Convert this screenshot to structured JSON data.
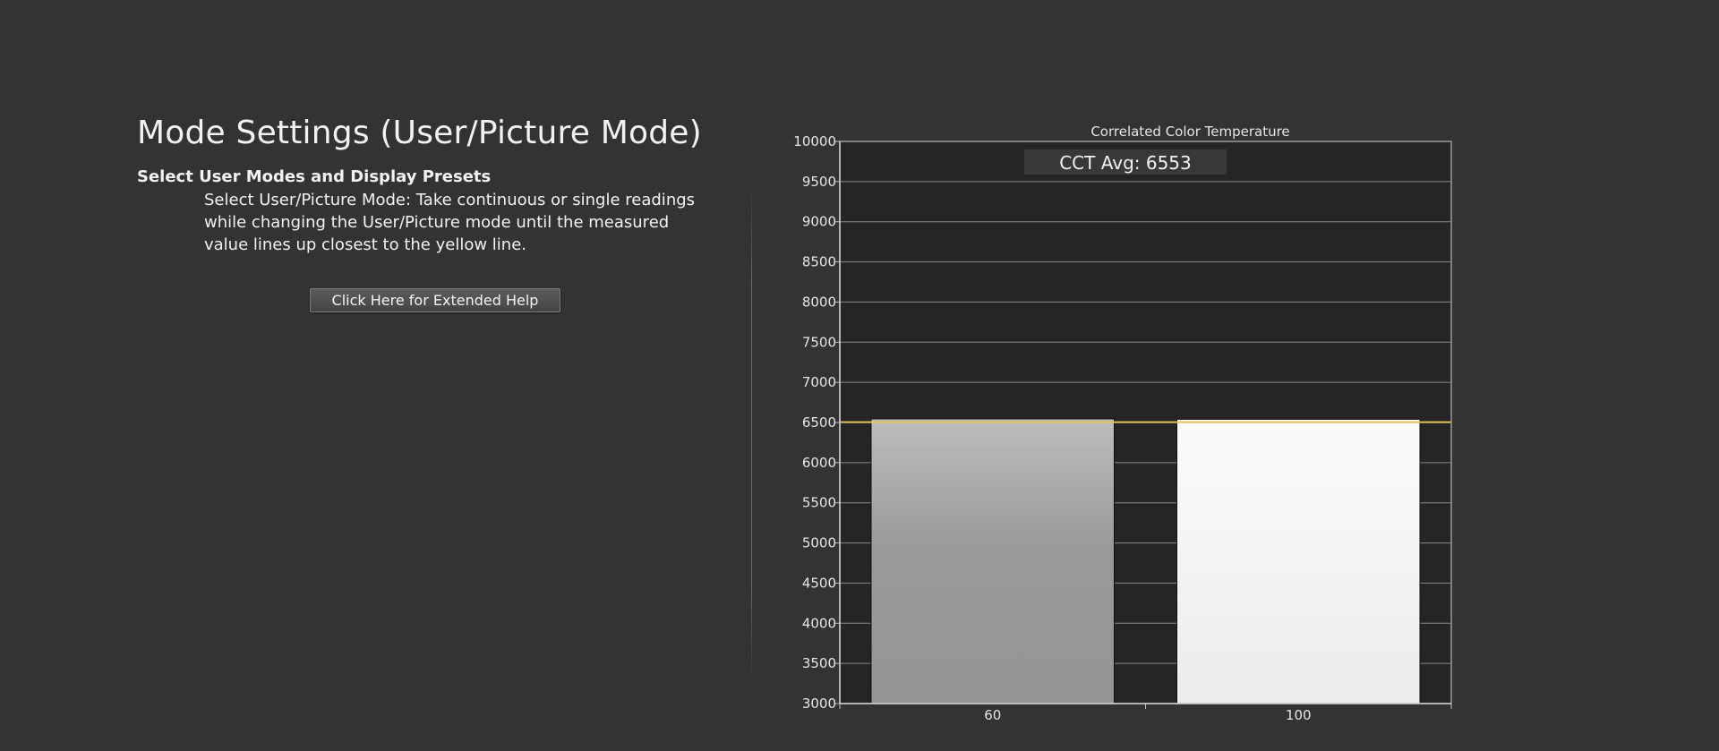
{
  "page": {
    "title": "Mode Settings (User/Picture Mode)",
    "section_heading": "Select User Modes and Display Presets",
    "instructions": "Select User/Picture Mode: Take continuous or single readings while changing the User/Picture mode until the measured value lines up closest to the yellow line.",
    "help_button_label": "Click Here for Extended Help"
  },
  "chart_data": {
    "type": "bar",
    "title": "Correlated Color Temperature",
    "annotation": "CCT Avg: 6553",
    "categories": [
      "60",
      "100"
    ],
    "values": [
      6545,
      6540
    ],
    "bar_styles": [
      "gray",
      "white"
    ],
    "target": 6504,
    "target_color": "#e3c060",
    "ylim": [
      3000,
      10000
    ],
    "yticks": [
      "3000",
      "3500",
      "4000",
      "4500",
      "5000",
      "5500",
      "6000",
      "6500",
      "7000",
      "7500",
      "8000",
      "8500",
      "9000",
      "9500",
      "10000"
    ],
    "xlabel": "",
    "ylabel": "",
    "grid": true
  }
}
